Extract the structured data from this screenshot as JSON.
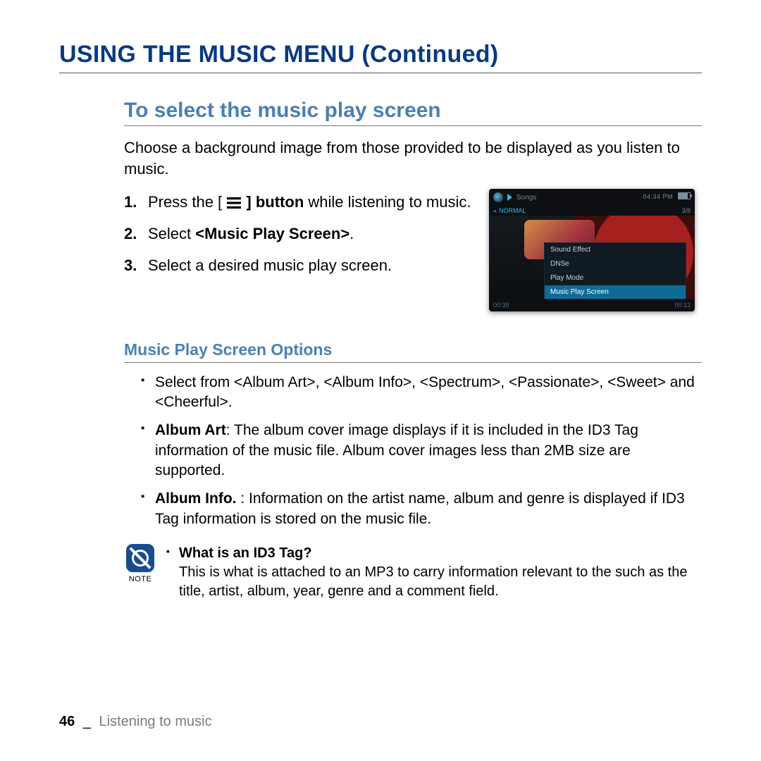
{
  "title": "USING THE MUSIC MENU (Continued)",
  "section": {
    "heading": "To select the music play screen",
    "intro": "Choose a background image from those provided to be displayed as you listen to music.",
    "steps": {
      "s1a": "Press the [",
      "s1b": "] button",
      "s1c": " while listening to music.",
      "s2a": "Select ",
      "s2b": "<Music Play Screen>",
      "s2c": ".",
      "s3": "Select a desired music play screen."
    }
  },
  "device": {
    "songs_label": "Songs",
    "clock": "04:34 PM",
    "track_index": "3/8",
    "mode": "NORMAL",
    "menu": [
      "Sound Effect",
      "DNSe",
      "Play Mode",
      "Music Play Screen"
    ],
    "menu_selected": "Music Play Screen",
    "time_elapsed": "00:39",
    "time_remaining": "00:12"
  },
  "options": {
    "heading": "Music Play Screen Options",
    "b1": "Select from <Album Art>, <Album Info>, <Spectrum>, <Passionate>, <Sweet> and <Cheerful>.",
    "b2_label": "Album Art",
    "b2_text": ": The album cover image displays if it is included in the ID3 Tag information of the music file. Album cover images less than 2MB size are supported.",
    "b3_label": "Album Info. ",
    "b3_text": ": Information on the artist name, album and genre is displayed if ID3 Tag information is stored on the music file."
  },
  "note": {
    "label": "NOTE",
    "question": "What is an ID3 Tag?",
    "answer": "This is what is attached to an MP3 to carry information relevant to the such as the title, artist, album, year, genre and a comment field."
  },
  "footer": {
    "page": "46",
    "separator": "_",
    "section": "Listening to music"
  }
}
